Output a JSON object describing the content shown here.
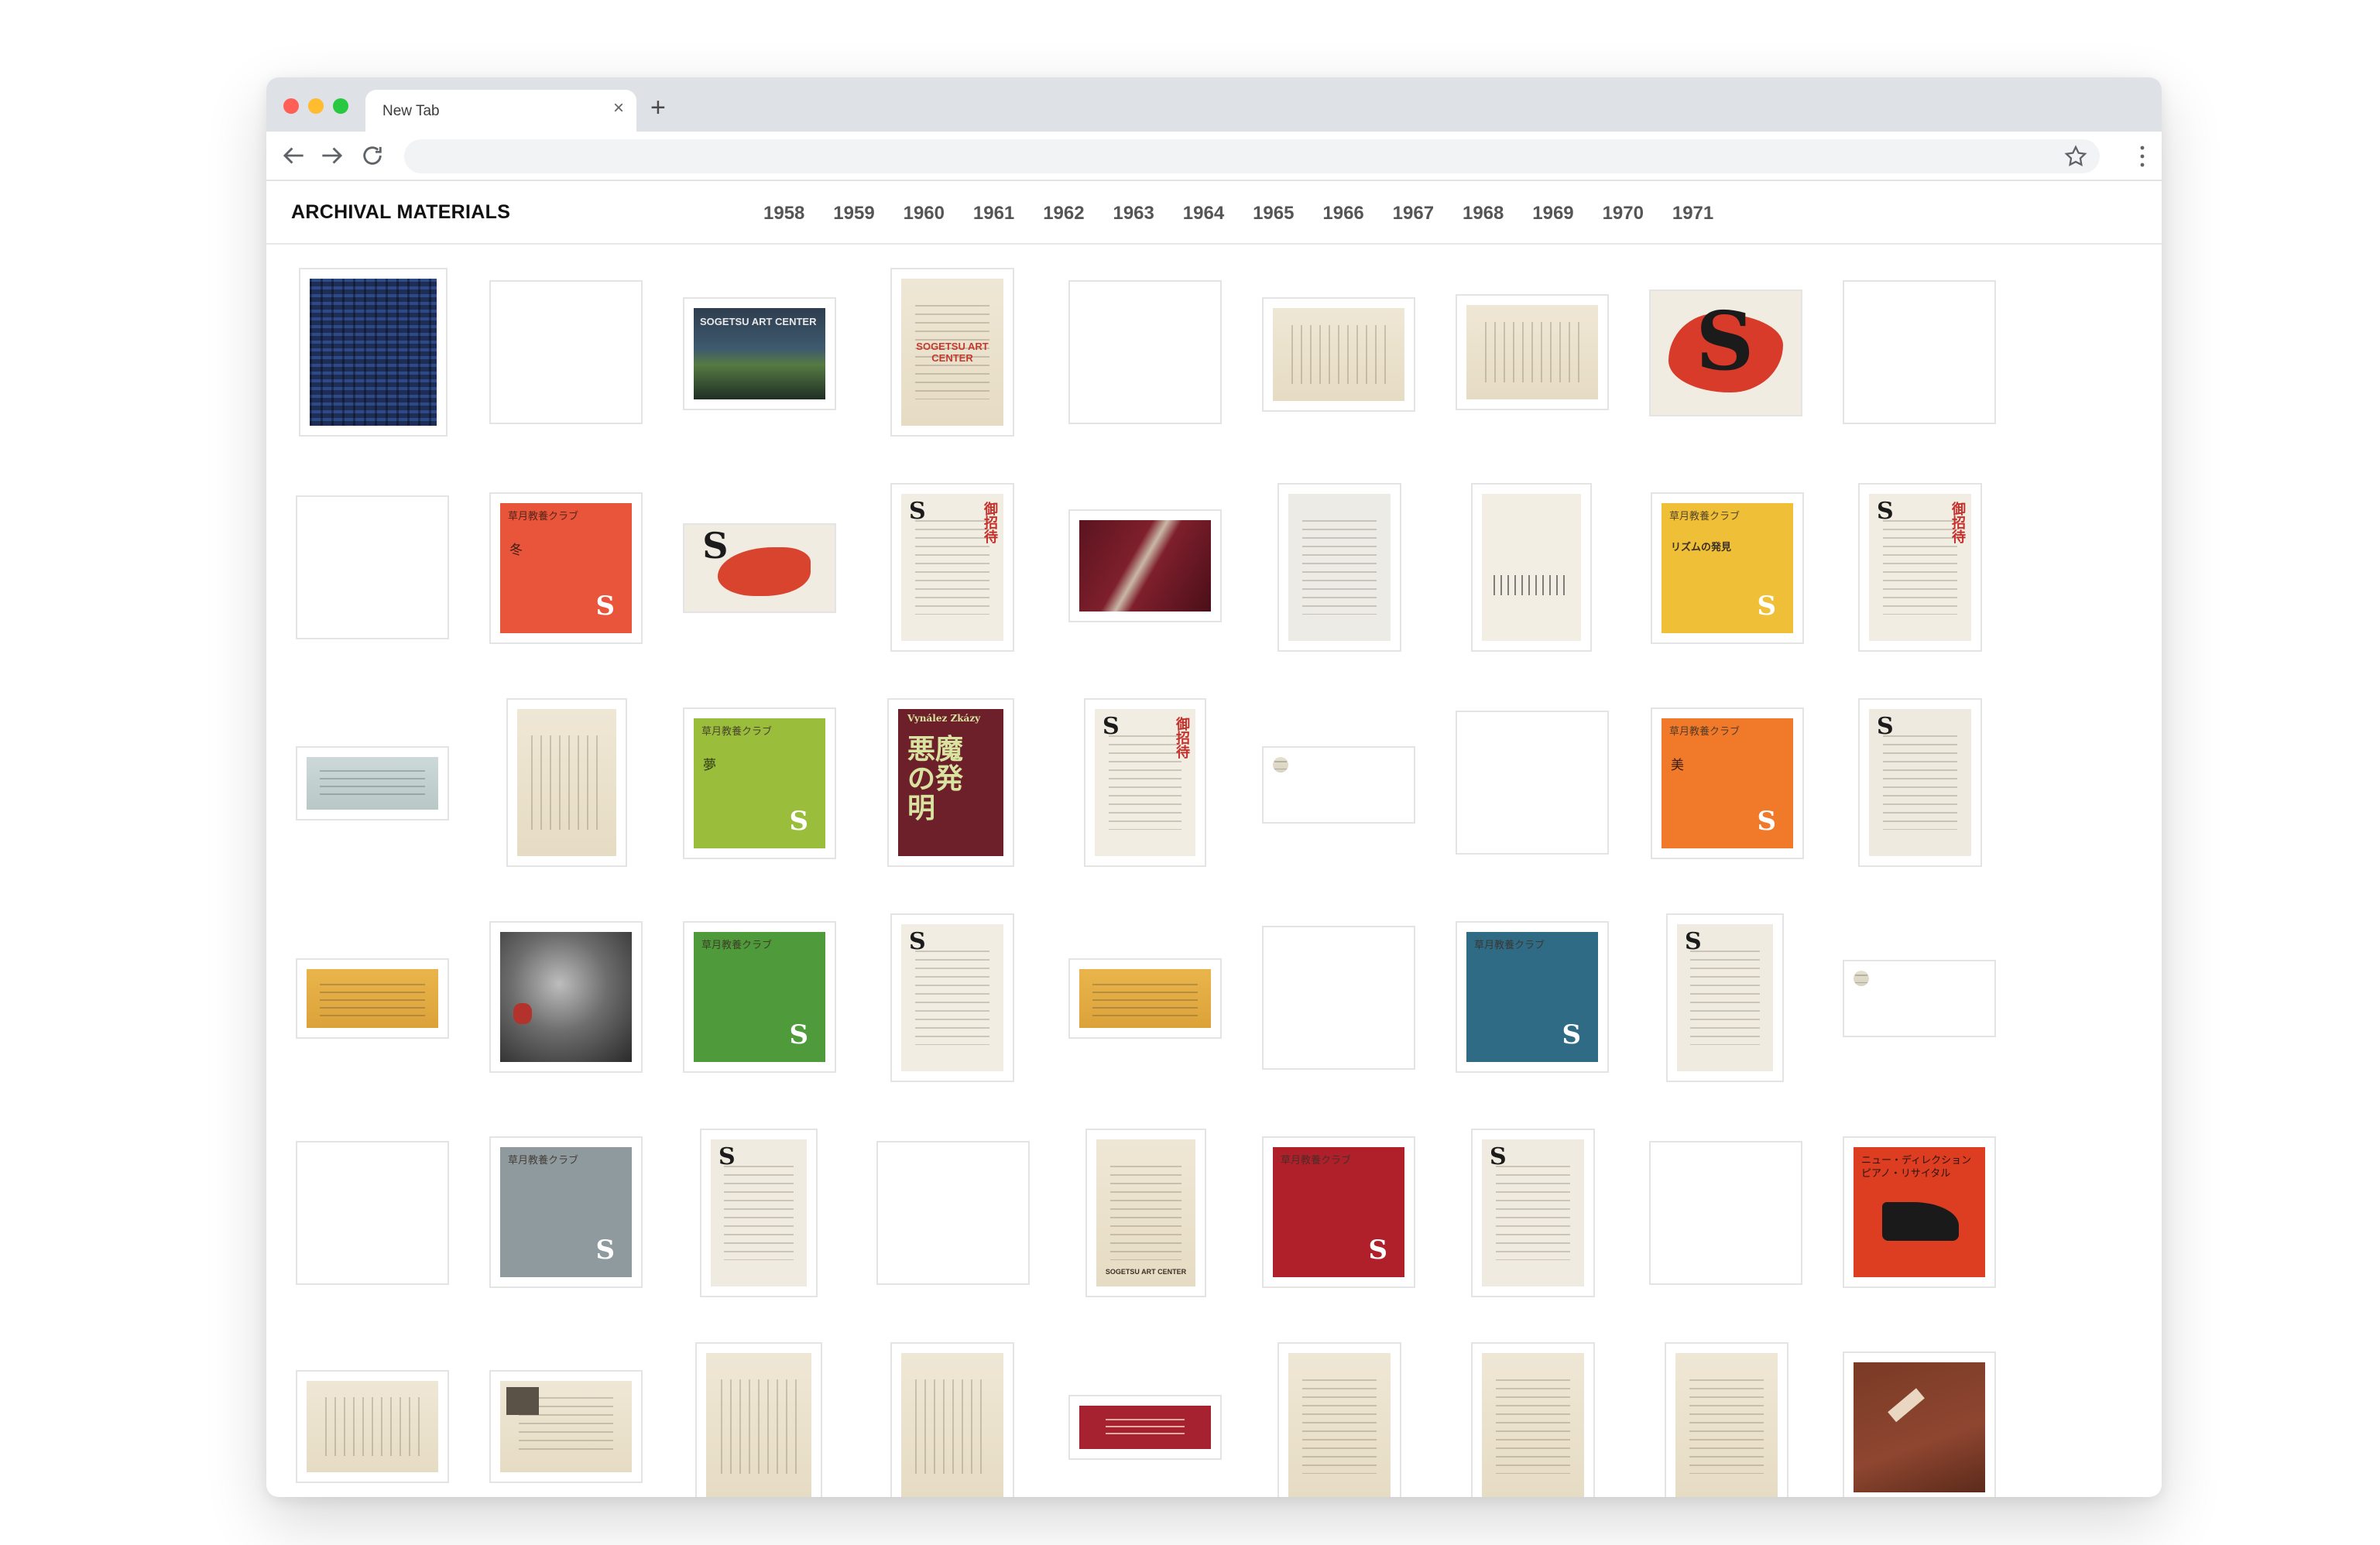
{
  "browser": {
    "tab_title": "New Tab",
    "tab_close": "×",
    "new_tab": "+",
    "address": ""
  },
  "site": {
    "title": "ARCHIVAL MATERIALS",
    "years": [
      "1958",
      "1959",
      "1960",
      "1961",
      "1962",
      "1963",
      "1964",
      "1965",
      "1966",
      "1967",
      "1968",
      "1969",
      "1970",
      "1971"
    ]
  },
  "covers": {
    "club_label": "草月教養クラブ",
    "ko": "冬",
    "yume": "夢",
    "bi": "美",
    "rhythm": "リズムの発見",
    "poster_top": "Vynález Zkázy",
    "poster_main": "悪魔の発明",
    "sac_banner": "SOGETSU ART CENTER",
    "sac_banner2": "SOGETSU ART CENTER",
    "sac_footer": "SOGETSU ART CENTER",
    "piano_title": "ニュー・ディレクション ピアノ・リサイタル",
    "logo_s": "S",
    "stamp": "御招待"
  },
  "colors": {
    "orange_red": "#e8553a",
    "lime": "#9bbd3c",
    "orange": "#f07a2a",
    "green": "#4f9a3a",
    "blue": "#2f6b84",
    "grey": "#8f9a9f",
    "crimson": "#b0202b",
    "mustard": "#efbf37"
  }
}
